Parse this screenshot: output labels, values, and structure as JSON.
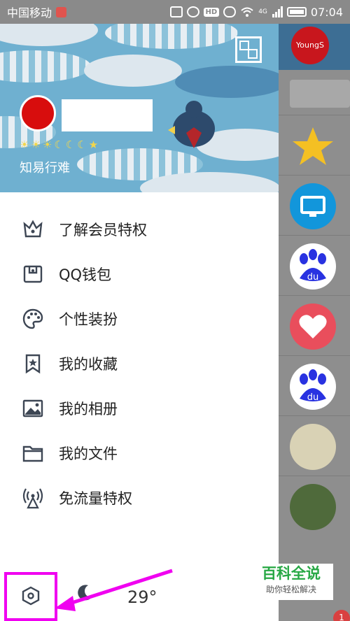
{
  "status_bar": {
    "carrier": "中国移动",
    "network": "4G",
    "hd": "HD",
    "time": "07:04"
  },
  "profile": {
    "motto": "知易行难",
    "level_icons": [
      "sun",
      "sun",
      "sun",
      "moon",
      "moon",
      "moon",
      "star"
    ]
  },
  "menu": {
    "items": [
      {
        "label": "了解会员特权",
        "icon": "crown-icon"
      },
      {
        "label": "QQ钱包",
        "icon": "wallet-icon"
      },
      {
        "label": "个性装扮",
        "icon": "palette-icon"
      },
      {
        "label": "我的收藏",
        "icon": "bookmark-star-icon"
      },
      {
        "label": "我的相册",
        "icon": "image-icon"
      },
      {
        "label": "我的文件",
        "icon": "folder-icon"
      },
      {
        "label": "免流量特权",
        "icon": "antenna-icon"
      }
    ]
  },
  "bottom": {
    "temperature": "29°"
  },
  "chat_avatars": [
    {
      "name": "YoungS",
      "icon": "youngs-logo",
      "color": "#c8161d"
    },
    {
      "name": "qzone",
      "icon": "qzone-star-icon",
      "color": "#f4c023"
    },
    {
      "name": "monitor",
      "icon": "monitor-icon",
      "color": "#1296db"
    },
    {
      "name": "baidu",
      "icon": "baidu-paw-icon",
      "color": "#2932e1"
    },
    {
      "name": "heart",
      "icon": "heart-icon",
      "color": "#e94e5c"
    },
    {
      "name": "baidu",
      "icon": "baidu-paw-icon",
      "color": "#2932e1"
    },
    {
      "name": "photo-1",
      "icon": "photo-avatar",
      "color": "#6b8a5a"
    },
    {
      "name": "photo-2",
      "icon": "photo-avatar",
      "color": "#4f6a3b"
    }
  ],
  "watermark": {
    "title": "百科全说",
    "subtitle": "助你轻松解决"
  },
  "badge": "1",
  "colors": {
    "highlight": "#f000f0",
    "banner": "#6fb0d0",
    "watermark_green": "#27a844"
  }
}
